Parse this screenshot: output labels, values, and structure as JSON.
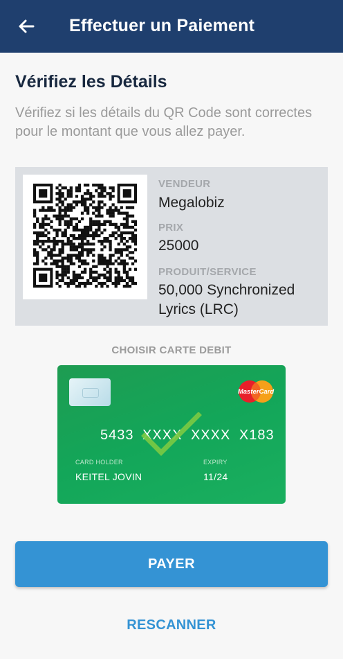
{
  "appbar": {
    "title": "Effectuer un Paiement",
    "back_icon": "arrow-left-icon"
  },
  "verify": {
    "title": "Vérifiez les Détails",
    "description": "Vérifiez si les détails du QR Code sont correctes pour le montant que vous allez payer."
  },
  "details": {
    "vendor_label": "VENDEUR",
    "vendor_value": "Megalobiz",
    "price_label": "PRIX",
    "price_value": "25000",
    "product_label": "PRODUIT/SERVICE",
    "product_value": "50,000 Synchronized Lyrics (LRC)"
  },
  "card_section": {
    "label": "CHOISIR CARTE DEBIT",
    "card": {
      "number": "5433 XXXX XXXX X183",
      "holder_label": "CARD HOLDER",
      "holder_value": "KEITEL JOVIN",
      "expiry_label": "EXPIRY",
      "expiry_value": "11/24",
      "brand_text": "MasterCard",
      "selected": true,
      "color": "#13a659"
    }
  },
  "actions": {
    "pay_label": "PAYER",
    "rescan_label": "RESCANNER"
  },
  "colors": {
    "appbar": "#1f3f6e",
    "primary": "#3493d4",
    "card_green": "#13a659",
    "check": "#7ac943"
  }
}
